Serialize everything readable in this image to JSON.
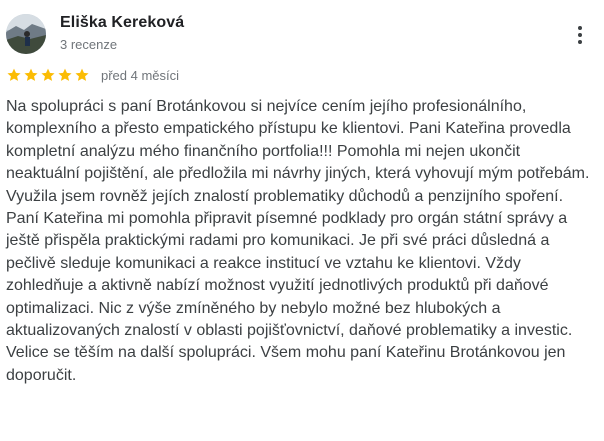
{
  "reviewer": {
    "name": "Eliška Kereková",
    "review_count": "3 recenze"
  },
  "rating": {
    "stars": 5,
    "max": 5,
    "color": "#fbbc04",
    "date": "před 4 měsíci"
  },
  "actions": {
    "more_icon": "more-vert-icon"
  },
  "review": {
    "text": "Na spolupráci s paní Brotánkovou si nejvíce cením jejího profesionálního, komplexního a přesto empatického přístupu ke klientovi. Pani Kateřina provedla kompletní analýzu mého finančního portfolia!!! Pomohla mi nejen ukončit neaktuální pojištění, ale předložila mi návrhy jiných, která vyhovují mým potřebám. Využila jsem rovněž jejích znalostí problematiky důchodů a penzijního spoření. Paní Kateřina mi pomohla připravit písemné podklady pro orgán státní správy a ještě přispěla praktickými radami pro komunikaci. Je při své práci důsledná a pečlivě sleduje komunikaci a reakce institucí ve vztahu ke klientovi. Vždy zohledňuje a aktivně nabízí možnost využití jednotlivých produktů při daňové optimalizaci. Nic z výše zmíněného by nebylo možné bez hlubokých a aktualizovaných znalostí v oblasti pojišťovnictví, daňové problematiky a investic.\nVelice se těším na další spolupráci. Všem mohu paní Kateřinu Brotánkovou jen doporučit."
  }
}
